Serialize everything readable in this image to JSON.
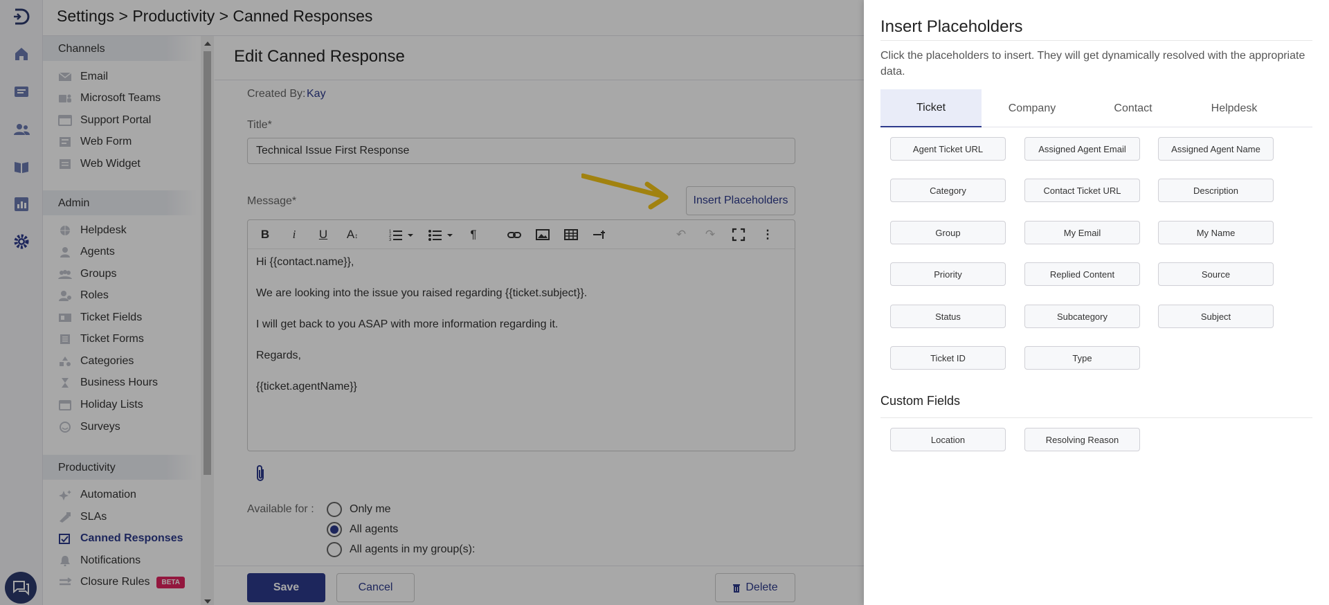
{
  "header": {
    "breadcrumb": "Settings > Productivity > Canned Responses"
  },
  "sidebar": {
    "channels_title": "Channels",
    "channels": [
      {
        "label": "Email",
        "icon": "envelope-icon"
      },
      {
        "label": "Microsoft Teams",
        "icon": "teams-icon"
      },
      {
        "label": "Support Portal",
        "icon": "portal-icon"
      },
      {
        "label": "Web Form",
        "icon": "form-icon"
      },
      {
        "label": "Web Widget",
        "icon": "widget-icon"
      }
    ],
    "admin_title": "Admin",
    "admin": [
      {
        "label": "Helpdesk",
        "icon": "globe-icon"
      },
      {
        "label": "Agents",
        "icon": "agent-icon"
      },
      {
        "label": "Groups",
        "icon": "groups-icon"
      },
      {
        "label": "Roles",
        "icon": "roles-icon"
      },
      {
        "label": "Ticket Fields",
        "icon": "ticket-fields-icon"
      },
      {
        "label": "Ticket Forms",
        "icon": "ticket-forms-icon"
      },
      {
        "label": "Categories",
        "icon": "categories-icon"
      },
      {
        "label": "Business Hours",
        "icon": "hourglass-icon"
      },
      {
        "label": "Holiday Lists",
        "icon": "calendar-icon"
      },
      {
        "label": "Surveys",
        "icon": "smiley-icon"
      }
    ],
    "productivity_title": "Productivity",
    "productivity": [
      {
        "label": "Automation",
        "icon": "sparkle-icon"
      },
      {
        "label": "SLAs",
        "icon": "sla-icon"
      },
      {
        "label": "Canned Responses",
        "icon": "canned-icon",
        "active": true
      },
      {
        "label": "Notifications",
        "icon": "bell-icon"
      },
      {
        "label": "Closure Rules",
        "icon": "closure-icon",
        "badge": "BETA"
      }
    ]
  },
  "form": {
    "heading": "Edit Canned Response",
    "created_by_label": "Created By:",
    "created_by_value": "Kay",
    "title_label": "Title*",
    "title_value": "Technical Issue First Response",
    "message_label": "Message*",
    "insert_placeholders_label": "Insert Placeholders",
    "message_lines": [
      "Hi {{contact.name}},",
      "We are looking into the issue you raised regarding {{ticket.subject}}.",
      "I will get back to you ASAP with more information regarding it.",
      "Regards,",
      "{{ticket.agentName}}"
    ],
    "available_for_label": "Available for :",
    "availability_options": [
      {
        "label": "Only me",
        "selected": false
      },
      {
        "label": "All agents",
        "selected": true
      },
      {
        "label": "All agents in my group(s):",
        "selected": false
      }
    ],
    "save_label": "Save",
    "cancel_label": "Cancel",
    "delete_label": "Delete"
  },
  "drawer": {
    "title": "Insert Placeholders",
    "description": "Click the placeholders to insert. They will get dynamically resolved with the appropriate data.",
    "tabs": [
      "Ticket",
      "Company",
      "Contact",
      "Helpdesk"
    ],
    "active_tab": "Ticket",
    "placeholders": [
      "Agent Ticket URL",
      "Assigned Agent Email",
      "Assigned Agent Name",
      "Category",
      "Contact Ticket URL",
      "Description",
      "Group",
      "My Email",
      "My Name",
      "Priority",
      "Replied Content",
      "Source",
      "Status",
      "Subcategory",
      "Subject",
      "Ticket ID",
      "Type"
    ],
    "custom_fields_title": "Custom Fields",
    "custom_fields": [
      "Location",
      "Resolving Reason"
    ]
  },
  "colors": {
    "accent": "#2d3a8c",
    "beta": "#e0245e",
    "arrow": "#f5c518"
  }
}
